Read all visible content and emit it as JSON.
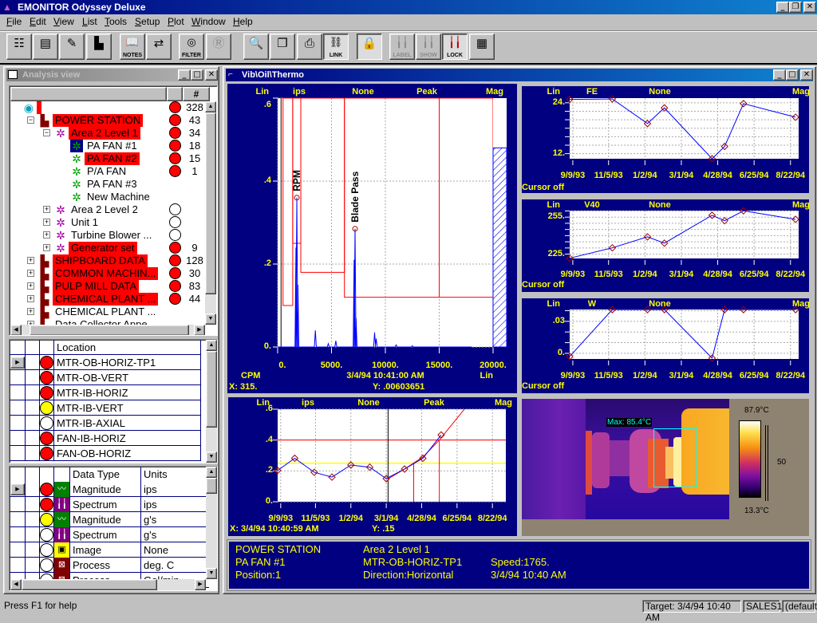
{
  "app": {
    "title": "EMONITOR Odyssey Deluxe"
  },
  "menu": [
    "File",
    "Edit",
    "View",
    "List",
    "Tools",
    "Setup",
    "Plot",
    "Window",
    "Help"
  ],
  "toolbar": [
    {
      "icon": "tree-view-icon",
      "label": ""
    },
    {
      "icon": "documents-icon",
      "label": ""
    },
    {
      "icon": "list-edit-icon",
      "label": ""
    },
    {
      "icon": "spectrum-plot-icon",
      "label": ""
    },
    {
      "icon": "notes-icon",
      "label": "NOTES"
    },
    {
      "icon": "transfer-icon",
      "label": ""
    },
    {
      "icon": "filter-icon",
      "label": "FILTER"
    },
    {
      "icon": "route-icon",
      "label": ""
    },
    {
      "icon": "magnifier-icon",
      "label": ""
    },
    {
      "icon": "copy-icon",
      "label": ""
    },
    {
      "icon": "printer-icon",
      "label": ""
    },
    {
      "icon": "link-icon",
      "label": "LINK"
    },
    {
      "icon": "padlock-icon",
      "label": ""
    },
    {
      "icon": "label-plot-icon",
      "label": "LABEL"
    },
    {
      "icon": "show-plot-icon",
      "label": "SHOW"
    },
    {
      "icon": "lock-plot-icon",
      "label": "LOCK"
    },
    {
      "icon": "calculator-icon",
      "label": ""
    }
  ],
  "analysis": {
    "title": "Analysis view",
    "count_header": "#",
    "tree": [
      {
        "label": "",
        "level": 0,
        "icon": "database",
        "exp": "",
        "status": "red",
        "count": "328",
        "hl": true
      },
      {
        "label": "POWER STATION",
        "level": 1,
        "icon": "plant",
        "exp": "-",
        "status": "red",
        "count": "43",
        "hl": true
      },
      {
        "label": "Area 2 Level 1",
        "level": 2,
        "icon": "area",
        "exp": "-",
        "status": "red",
        "count": "34",
        "hl": true
      },
      {
        "label": "PA FAN #1",
        "level": 3,
        "icon": "machine",
        "exp": "",
        "status": "red",
        "count": "18",
        "hl": false,
        "sel": true
      },
      {
        "label": "PA FAN #2",
        "level": 3,
        "icon": "machine",
        "exp": "",
        "status": "red",
        "count": "15",
        "hl": true
      },
      {
        "label": "P/A FAN",
        "level": 3,
        "icon": "machine",
        "exp": "",
        "status": "red",
        "count": "1",
        "hl": false
      },
      {
        "label": "PA FAN #3",
        "level": 3,
        "icon": "machine",
        "exp": "",
        "status": "",
        "count": "",
        "hl": false
      },
      {
        "label": "New Machine",
        "level": 3,
        "icon": "machine",
        "exp": "",
        "status": "",
        "count": "",
        "hl": false
      },
      {
        "label": "Area 2 Level 2",
        "level": 2,
        "icon": "area",
        "exp": "+",
        "status": "white",
        "count": "",
        "hl": false
      },
      {
        "label": "Unit 1",
        "level": 2,
        "icon": "area",
        "exp": "+",
        "status": "white",
        "count": "",
        "hl": false
      },
      {
        "label": "Turbine Blower ...",
        "level": 2,
        "icon": "area",
        "exp": "+",
        "status": "white",
        "count": "",
        "hl": false
      },
      {
        "label": "Generator set",
        "level": 2,
        "icon": "area",
        "exp": "+",
        "status": "red",
        "count": "9",
        "hl": true
      },
      {
        "label": "SHIPBOARD DATA",
        "level": 1,
        "icon": "plant",
        "exp": "+",
        "status": "red",
        "count": "128",
        "hl": true
      },
      {
        "label": "COMMON MACHIN...",
        "level": 1,
        "icon": "plant",
        "exp": "+",
        "status": "red",
        "count": "30",
        "hl": true
      },
      {
        "label": "PULP MILL DATA",
        "level": 1,
        "icon": "plant",
        "exp": "+",
        "status": "red",
        "count": "83",
        "hl": true
      },
      {
        "label": "CHEMICAL PLANT ...",
        "level": 1,
        "icon": "plant",
        "exp": "+",
        "status": "red",
        "count": "44",
        "hl": true
      },
      {
        "label": "CHEMICAL PLANT ...",
        "level": 1,
        "icon": "plant",
        "exp": "+",
        "status": "",
        "count": "",
        "hl": false
      },
      {
        "label": "Data Collector Appe...",
        "level": 1,
        "icon": "plant",
        "exp": "+",
        "status": "",
        "count": "",
        "hl": false
      }
    ]
  },
  "locations": {
    "header": "Location",
    "rows": [
      {
        "status": "red",
        "name": "MTR-OB-HORIZ-TP1",
        "current": true
      },
      {
        "status": "red",
        "name": "MTR-OB-VERT"
      },
      {
        "status": "red",
        "name": "MTR-IB-HORIZ"
      },
      {
        "status": "yellow",
        "name": "MTR-IB-VERT"
      },
      {
        "status": "white",
        "name": "MTR-IB-AXIAL"
      },
      {
        "status": "red",
        "name": "FAN-IB-HORIZ"
      },
      {
        "status": "red",
        "name": "FAN-OB-HORIZ"
      }
    ]
  },
  "datatypes": {
    "headers": [
      "Data Type",
      "Units"
    ],
    "rows": [
      {
        "status": "red",
        "icon": "trend",
        "type": "Magnitude",
        "units": "ips",
        "current": true
      },
      {
        "status": "red",
        "icon": "spectrum",
        "type": "Spectrum",
        "units": "ips"
      },
      {
        "status": "yellow",
        "icon": "trend",
        "type": "Magnitude",
        "units": "g's"
      },
      {
        "status": "white",
        "icon": "spectrum",
        "type": "Spectrum",
        "units": "g's"
      },
      {
        "status": "white",
        "icon": "image",
        "type": "Image",
        "units": "None"
      },
      {
        "status": "white",
        "icon": "process",
        "type": "Process",
        "units": "deg. C"
      },
      {
        "status": "white",
        "icon": "process",
        "type": "Process",
        "units": "Gal/min"
      }
    ]
  },
  "child_window": {
    "title": "Vib\\Oil\\Thermo"
  },
  "colors": {
    "panel": "#000080",
    "text": "#ffff00",
    "plot_line": "#0000ff",
    "alarm": "#ff0000",
    "alert": "#ffff00",
    "marker": "#a00000"
  },
  "chart_data": [
    {
      "id": "spectrum",
      "type": "line",
      "header": [
        "Lin",
        "ips",
        "None",
        "Peak",
        "Mag"
      ],
      "xlim": [
        0,
        20000
      ],
      "ylim": [
        0,
        0.6
      ],
      "xticks": [
        "0.",
        "5000.",
        "10000.",
        "15000.",
        "20000."
      ],
      "xtick_values": [
        0,
        5000,
        10000,
        15000,
        20000
      ],
      "yticks": [
        ".6",
        ".4",
        ".2",
        "0."
      ],
      "ytick_values": [
        0.6,
        0.4,
        0.2,
        0
      ],
      "xlabel": "CPM",
      "xscale": "Lin",
      "timestamp": "3/4/94 10:41:00 AM",
      "cursor": {
        "x_label": "X: 315.",
        "y_label": "Y: .00603651",
        "x": 315
      },
      "peaks": [
        [
          1780,
          0.36
        ],
        [
          1700,
          0.24
        ],
        [
          1880,
          0.15
        ],
        [
          3500,
          0.04
        ],
        [
          4700,
          0.008
        ],
        [
          5400,
          0.015
        ],
        [
          7185,
          0.285
        ],
        [
          7100,
          0.21
        ],
        [
          7280,
          0.07
        ],
        [
          9000,
          0.035
        ],
        [
          9150,
          0.02
        ],
        [
          11000,
          0.005
        ],
        [
          12500,
          0.003
        ]
      ],
      "annotations": [
        {
          "text": "RPM",
          "x": 1780,
          "y": 0.36
        },
        {
          "text": "Blade Pass",
          "x": 7185,
          "y": 0.285
        }
      ],
      "alarm_bands": [
        {
          "from": 500,
          "to": 1400,
          "level": 0.1
        },
        {
          "from": 1400,
          "to": 2150,
          "level": 0.25
        },
        {
          "from": 2150,
          "to": 6200,
          "level": 0.18
        },
        {
          "from": 6200,
          "to": 15000,
          "level": 0.12
        },
        {
          "from": 15000,
          "to": 20000,
          "level": 0.12
        }
      ],
      "overall_level": 0.48
    },
    {
      "id": "trend-fe",
      "type": "line",
      "header": [
        "Lin",
        "FE",
        "None",
        "Mag"
      ],
      "xlim": [
        "9/4/93",
        "9/4/94"
      ],
      "ylim": [
        10.8,
        25.1
      ],
      "yticks": [
        "24.",
        "12."
      ],
      "ytick_values": [
        24,
        12
      ],
      "yminor": 2,
      "xticks": [
        "9/9/93",
        "11/5/93",
        "1/2/94",
        "3/1/94",
        "4/28/94",
        "6/25/94",
        "8/22/94"
      ],
      "x": [
        "9/4/93",
        "11/11/93",
        "1/6/94",
        "2/2/94",
        "4/19/94",
        "5/9/94",
        "6/8/94",
        "8/30/94"
      ],
      "y": [
        24.8,
        24.9,
        19.1,
        22.8,
        10.8,
        13.7,
        23.8,
        20.6
      ],
      "footer": "Cursor off"
    },
    {
      "id": "trend-v40",
      "type": "line",
      "header": [
        "Lin",
        "V40",
        "None",
        "Mag"
      ],
      "xlim": [
        "9/4/93",
        "9/4/94"
      ],
      "ylim": [
        221.5,
        260.3
      ],
      "yticks": [
        "255.",
        "225."
      ],
      "ytick_values": [
        255,
        225
      ],
      "yminor": 5,
      "xticks": [
        "9/9/93",
        "11/5/93",
        "1/2/94",
        "3/1/94",
        "4/28/94",
        "6/25/94",
        "8/22/94"
      ],
      "x": [
        "9/4/93",
        "11/11/93",
        "1/6/94",
        "2/2/94",
        "4/19/94",
        "5/9/94",
        "6/8/94",
        "8/30/94"
      ],
      "y": [
        221.7,
        230.1,
        239,
        233.9,
        256.5,
        252.1,
        260.1,
        253.2
      ],
      "footer": "Cursor off"
    },
    {
      "id": "trend-w",
      "type": "line",
      "header": [
        "Lin",
        "W",
        "None",
        "Mag"
      ],
      "xlim": [
        "9/4/93",
        "9/4/94"
      ],
      "ylim": [
        -0.0053,
        0.0411
      ],
      "yticks": [
        ".03",
        "0."
      ],
      "ytick_values": [
        0.03,
        0
      ],
      "yminor": 0.01,
      "xticks": [
        "9/9/93",
        "11/5/93",
        "1/2/94",
        "3/1/94",
        "4/28/94",
        "6/25/94",
        "8/22/94"
      ],
      "x": [
        "9/4/93",
        "11/11/93",
        "1/6/94",
        "2/2/94",
        "4/19/94",
        "5/9/94",
        "6/8/94",
        "8/30/94"
      ],
      "y": [
        -0.003,
        0.041,
        0.041,
        0.041,
        -0.0045,
        0.041,
        0.041,
        0.041
      ],
      "footer": "Cursor off"
    },
    {
      "id": "trend-ips",
      "type": "line",
      "header": [
        "Lin",
        "ips",
        "None",
        "Peak",
        "Mag"
      ],
      "xlim": [
        "9/4/93",
        "9/13/94"
      ],
      "ylim": [
        0,
        0.6
      ],
      "yticks": [
        ".6",
        ".4",
        ".2",
        "0."
      ],
      "ytick_values": [
        0.6,
        0.4,
        0.2,
        0
      ],
      "xticks": [
        "9/9/93",
        "11/5/93",
        "1/2/94",
        "3/1/94",
        "4/28/94",
        "6/25/94",
        "8/22/94"
      ],
      "x": [
        "9/4/93",
        "10/2/93",
        "11/3/93",
        "12/2/93",
        "1/2/94",
        "2/2/94",
        "3/1/94",
        "3/31/94",
        "4/30/94",
        "5/30/94"
      ],
      "y": [
        0.203,
        0.282,
        0.191,
        0.16,
        0.238,
        0.224,
        0.15,
        0.212,
        0.282,
        0.433
      ],
      "projection": {
        "x": [
          "3/3/94",
          "3/30/94",
          "4/30/94",
          "5/27/94",
          "7/8/94"
        ],
        "y": [
          0.146,
          0.21,
          0.29,
          0.4,
          0.605
        ]
      },
      "alert_level": 0.25,
      "alarm_level": 0.4,
      "alert_cross": "4/15/94",
      "alarm_cross": "5/27/94",
      "cursor_date": "3/4/94",
      "cursor": {
        "x_label": "X: 3/4/94 10:40:59 AM",
        "y_label": "Y: .15"
      }
    }
  ],
  "thermal": {
    "max_label": "Max: 85.4°C",
    "scale_max": "87.9°C",
    "scale_mid": "50",
    "scale_min": "13.3°C"
  },
  "info": {
    "col1": [
      "POWER STATION",
      "PA FAN #1",
      "Position:1"
    ],
    "col2": [
      "Area 2 Level 1",
      "MTR-OB-HORIZ-TP1",
      "Direction:Horizontal"
    ],
    "col3": [
      "",
      "Speed:1765.",
      "3/4/94 10:40 AM"
    ]
  },
  "statusbar": {
    "help": "Press F1 for help",
    "target": "Target: 3/4/94 10:40 AM",
    "user": "SALES1",
    "profile": "(default)"
  }
}
